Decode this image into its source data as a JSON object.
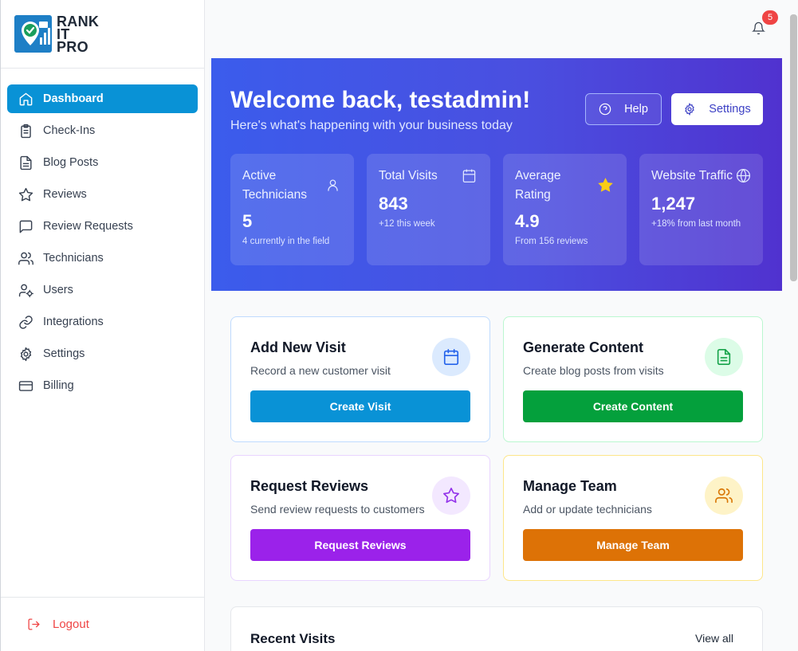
{
  "brand": {
    "line1": "RANK",
    "line2": "IT",
    "line3": "PRO"
  },
  "sidebar": {
    "items": [
      {
        "label": "Dashboard",
        "icon": "home-icon",
        "active": true
      },
      {
        "label": "Check-Ins",
        "icon": "clipboard-icon"
      },
      {
        "label": "Blog Posts",
        "icon": "document-icon"
      },
      {
        "label": "Reviews",
        "icon": "star-icon"
      },
      {
        "label": "Review Requests",
        "icon": "chat-icon"
      },
      {
        "label": "Technicians",
        "icon": "users-icon"
      },
      {
        "label": "Users",
        "icon": "user-gear-icon"
      },
      {
        "label": "Integrations",
        "icon": "link-icon"
      },
      {
        "label": "Settings",
        "icon": "gear-icon"
      },
      {
        "label": "Billing",
        "icon": "card-icon"
      }
    ],
    "logout": "Logout"
  },
  "topbar": {
    "notifications": "5"
  },
  "hero": {
    "title": "Welcome back, testadmin!",
    "subtitle": "Here's what's happening with your business today",
    "help": "Help",
    "settings": "Settings",
    "stats": [
      {
        "label": "Active Technicians",
        "value": "5",
        "note": "4 currently in the field"
      },
      {
        "label": "Total Visits",
        "value": "843",
        "note": "+12 this week"
      },
      {
        "label": "Average Rating",
        "value": "4.9",
        "note": "From 156 reviews"
      },
      {
        "label": "Website Traffic",
        "value": "1,247",
        "note": "+18% from last month"
      }
    ]
  },
  "actions": [
    {
      "title": "Add New Visit",
      "desc": "Record a new customer visit",
      "button": "Create Visit"
    },
    {
      "title": "Generate Content",
      "desc": "Create blog posts from visits",
      "button": "Create Content"
    },
    {
      "title": "Request Reviews",
      "desc": "Send review requests to customers",
      "button": "Request Reviews"
    },
    {
      "title": "Manage Team",
      "desc": "Add or update technicians",
      "button": "Manage Team"
    }
  ],
  "recent": {
    "title": "Recent Visits",
    "view_all": "View all"
  },
  "colors": {
    "primary": "#0992d6",
    "green": "#04a03c",
    "purple": "#9b22ea",
    "amber": "#dd7206",
    "danger": "#ef4444"
  }
}
